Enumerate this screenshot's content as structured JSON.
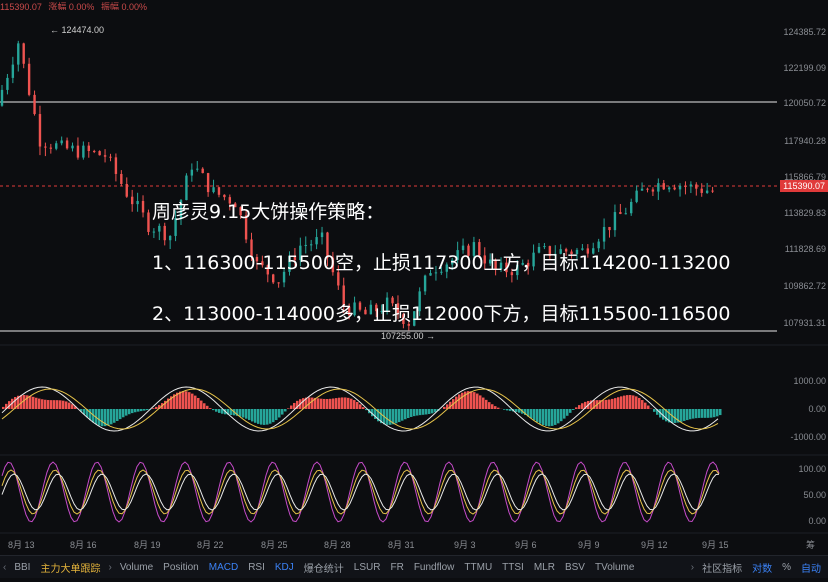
{
  "topbar": {
    "items": [
      "115390.07",
      "涨幅 0.00%",
      "振幅 0.00%"
    ]
  },
  "chart": {
    "high_annotation": "← 124474.00",
    "low_annotation": "107255.00 →",
    "last_price": "115390.07",
    "y_labels": [
      "124385.72",
      "122199.09",
      "120050.72",
      "117940.28",
      "115866.79",
      "113829.83",
      "111828.69",
      "109862.72",
      "107931.31"
    ],
    "macd_labels": [
      "1000.00",
      "0.00",
      "-1000.00"
    ],
    "kdj_labels": [
      "100.00",
      "50.00",
      "0.00"
    ],
    "x_labels": [
      "8月 13",
      "8月 16",
      "8月 19",
      "8月 22",
      "8月 25",
      "8月 28",
      "8月 31",
      "9月 3",
      "9月 6",
      "9月 9",
      "9月 12",
      "9月 15"
    ],
    "axis_corner": "筹"
  },
  "chart_data": {
    "type": "line",
    "x_range": [
      "8月13",
      "9月15"
    ],
    "ylim": [
      107255,
      124474
    ],
    "high": 124474.0,
    "low": 107255.0,
    "last": 115390.07,
    "horizontal_levels": [
      120050.72,
      115390.07,
      107931.31
    ],
    "series": [
      {
        "x": [
          "8月13",
          "8月14",
          "8月15",
          "8月16",
          "8月17",
          "8月18",
          "8月19",
          "8月20",
          "8月21",
          "8月22",
          "8月23",
          "8月24",
          "8月25",
          "8月26",
          "8月27",
          "8月28",
          "8月29",
          "8月30",
          "8月31",
          "9月1",
          "9月2",
          "9月3",
          "9月4",
          "9月5",
          "9月6",
          "9月7",
          "9月8",
          "9月9",
          "9月10",
          "9月11",
          "9月12",
          "9月13",
          "9月14",
          "9月15"
        ],
        "values": [
          120200,
          123800,
          118300,
          117800,
          117600,
          117400,
          115300,
          113500,
          112900,
          116900,
          115300,
          114800,
          111200,
          110400,
          112300,
          112600,
          108900,
          108400,
          109000,
          108000,
          111000,
          111500,
          112300,
          110900,
          111000,
          111900,
          112000,
          112000,
          113200,
          114300,
          115700,
          115900,
          115600,
          115390
        ]
      }
    ]
  },
  "overlay": {
    "title": "周彦灵9.15大饼操作策略：",
    "line1": "1、116300-115500空，止损117300上方，目标114200-113200",
    "line2": "2、113000-114000多，止损112000下方，目标115500-116500"
  },
  "bottombar": {
    "first": "BBI",
    "label_main": "主力大单跟踪",
    "tabs": [
      "Volume",
      "Position",
      "MACD",
      "RSI",
      "KDJ",
      "爆仓统计",
      "LSUR",
      "FR",
      "Fundflow",
      "TTMU",
      "TTSI",
      "MLR",
      "BSV",
      "TVolume"
    ],
    "active_tabs": [
      "MACD",
      "KDJ"
    ],
    "right_items": [
      "社区指标",
      "对数",
      "%",
      "自动"
    ]
  },
  "colors": {
    "up": "#26a69a",
    "down": "#ef5350",
    "accent": "#3b82f6",
    "price": "#e03a3a"
  }
}
